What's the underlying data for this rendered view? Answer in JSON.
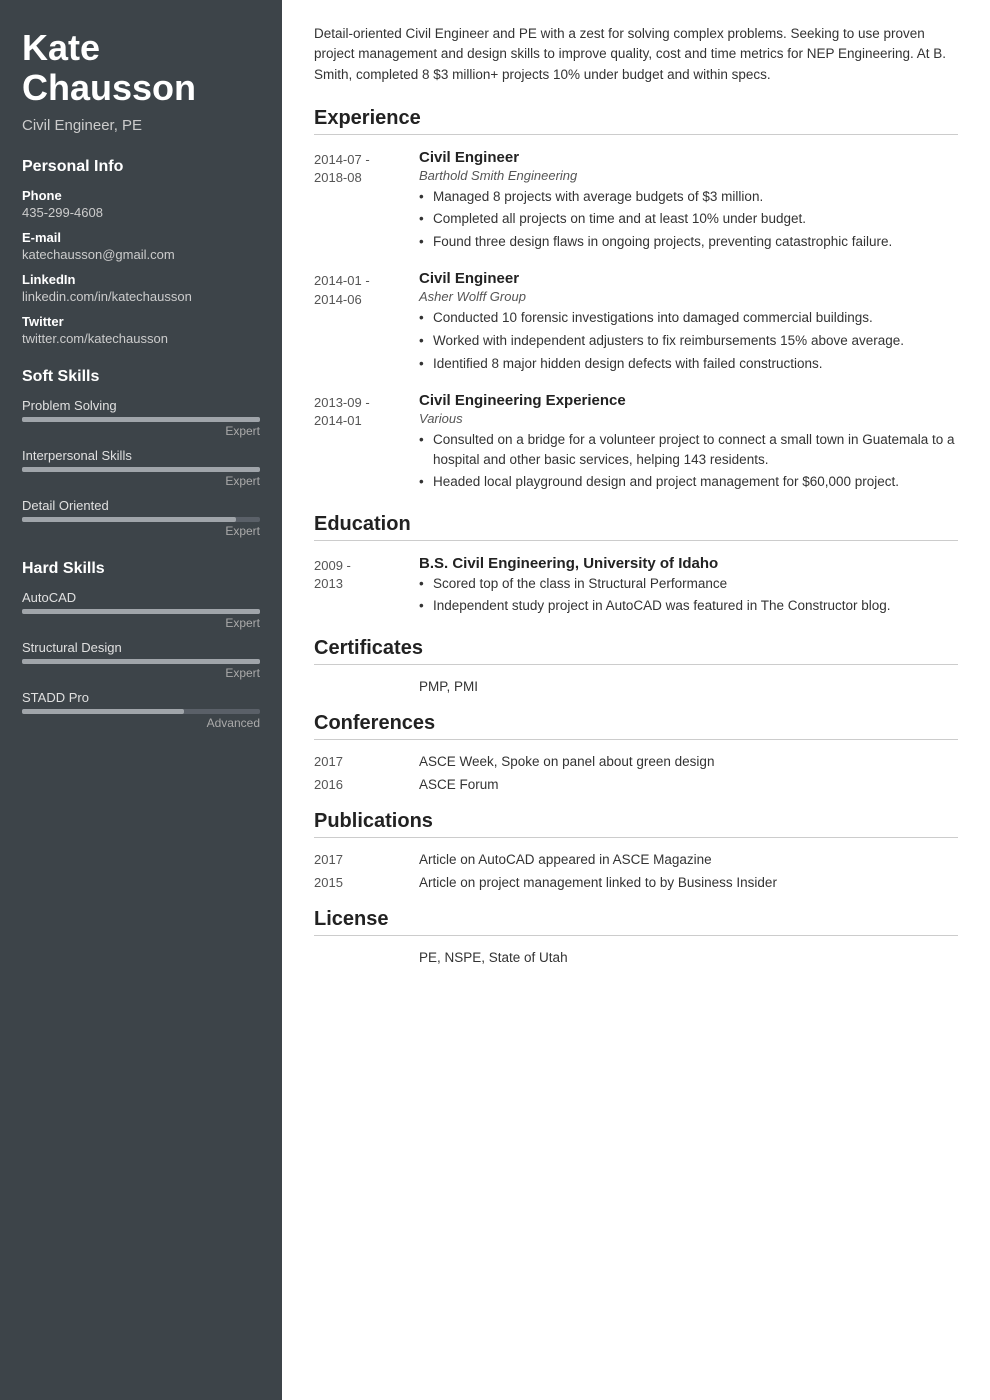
{
  "sidebar": {
    "name": "Kate\nChausson",
    "name_line1": "Kate",
    "name_line2": "Chausson",
    "job_title": "Civil Engineer, PE",
    "personal_info_heading": "Personal Info",
    "phone_label": "Phone",
    "phone_value": "435-299-4608",
    "email_label": "E-mail",
    "email_value": "katechausson@gmail.com",
    "linkedin_label": "LinkedIn",
    "linkedin_value": "linkedin.com/in/katechausson",
    "twitter_label": "Twitter",
    "twitter_value": "twitter.com/katechausson",
    "soft_skills_heading": "Soft Skills",
    "soft_skills": [
      {
        "name": "Problem Solving",
        "level": "Expert",
        "pct": 100
      },
      {
        "name": "Interpersonal Skills",
        "level": "Expert",
        "pct": 100
      },
      {
        "name": "Detail Oriented",
        "level": "Expert",
        "pct": 90
      }
    ],
    "hard_skills_heading": "Hard Skills",
    "hard_skills": [
      {
        "name": "AutoCAD",
        "level": "Expert",
        "pct": 100
      },
      {
        "name": "Structural Design",
        "level": "Expert",
        "pct": 100
      },
      {
        "name": "STADD Pro",
        "level": "Advanced",
        "pct": 70
      }
    ]
  },
  "main": {
    "summary": "Detail-oriented Civil Engineer and PE with a zest for solving complex problems. Seeking to use proven project management and design skills to improve quality, cost and time metrics for NEP Engineering. At B. Smith, completed 8 $3 million+ projects 10% under budget and within specs.",
    "experience_heading": "Experience",
    "experience": [
      {
        "date": "2014-07 -\n2018-08",
        "title": "Civil Engineer",
        "company": "Barthold Smith Engineering",
        "bullets": [
          "Managed 8 projects with average budgets of $3 million.",
          "Completed all projects on time and at least 10% under budget.",
          "Found three design flaws in ongoing projects, preventing catastrophic failure."
        ]
      },
      {
        "date": "2014-01 -\n2014-06",
        "title": "Civil Engineer",
        "company": "Asher Wolff Group",
        "bullets": [
          "Conducted 10 forensic investigations into damaged commercial buildings.",
          "Worked with independent adjusters to fix reimbursements 15% above average.",
          "Identified 8 major hidden design defects with failed constructions."
        ]
      },
      {
        "date": "2013-09 -\n2014-01",
        "title": "Civil Engineering Experience",
        "company": "Various",
        "bullets": [
          "Consulted on a bridge for a volunteer project to connect a small town in Guatemala to a hospital and other basic services, helping 143 residents.",
          "Headed local playground design and project management for $60,000 project."
        ]
      }
    ],
    "education_heading": "Education",
    "education": [
      {
        "date": "2009 -\n2013",
        "title": "B.S. Civil Engineering, University of Idaho",
        "company": "",
        "bullets": [
          "Scored top of the class in Structural Performance",
          "Independent study project in AutoCAD was featured in The Constructor blog."
        ]
      }
    ],
    "certificates_heading": "Certificates",
    "certificates": "PMP, PMI",
    "conferences_heading": "Conferences",
    "conferences": [
      {
        "date": "2017",
        "text": "ASCE Week, Spoke on panel about green design"
      },
      {
        "date": "2016",
        "text": "ASCE Forum"
      }
    ],
    "publications_heading": "Publications",
    "publications": [
      {
        "date": "2017",
        "text": "Article on AutoCAD appeared in ASCE Magazine"
      },
      {
        "date": "2015",
        "text": "Article on project management linked to by Business Insider"
      }
    ],
    "license_heading": "License",
    "license": "PE, NSPE, State of Utah"
  }
}
